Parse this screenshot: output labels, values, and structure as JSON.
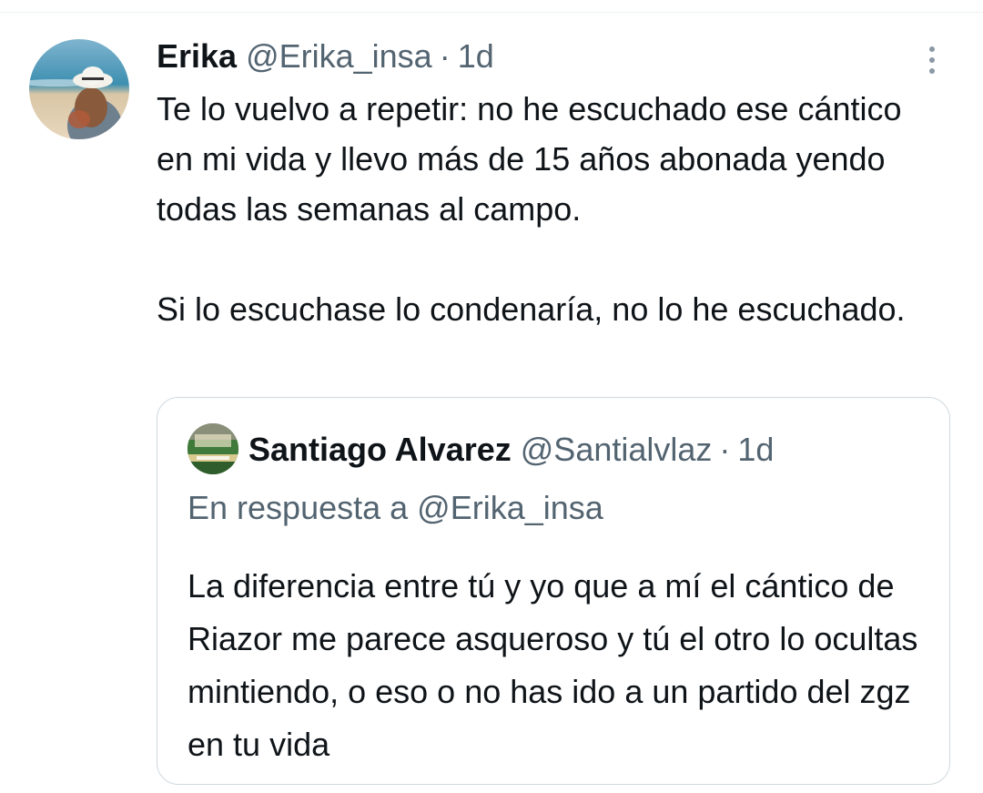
{
  "tweet": {
    "author_name": "Erika",
    "author_handle": "@Erika_insa",
    "separator": "·",
    "time": "1d",
    "paragraph_1": "Te lo vuelvo a repetir: no he escuchado ese cántico en mi vida y llevo más de 15 años abonada yendo todas las semanas al campo.",
    "paragraph_2": "Si lo escuchase lo condenaría, no lo he escuchado.",
    "more_icon": "more-vertical-icon"
  },
  "quote": {
    "author_name": "Santiago Alvarez",
    "author_handle": "@Santialvlaz",
    "separator": "·",
    "time": "1d",
    "reply_prefix": "En respuesta a",
    "reply_to": "@Erika_insa",
    "text": "La diferencia entre tú y yo que a mí el cántico de Riazor me parece asqueroso y tú el otro lo ocultas mintiendo, o eso o no has ido a un partido del zgz en tu vida"
  },
  "colors": {
    "text_primary": "#0f1419",
    "text_secondary": "#536471",
    "border": "#cfd9de",
    "background": "#ffffff"
  }
}
